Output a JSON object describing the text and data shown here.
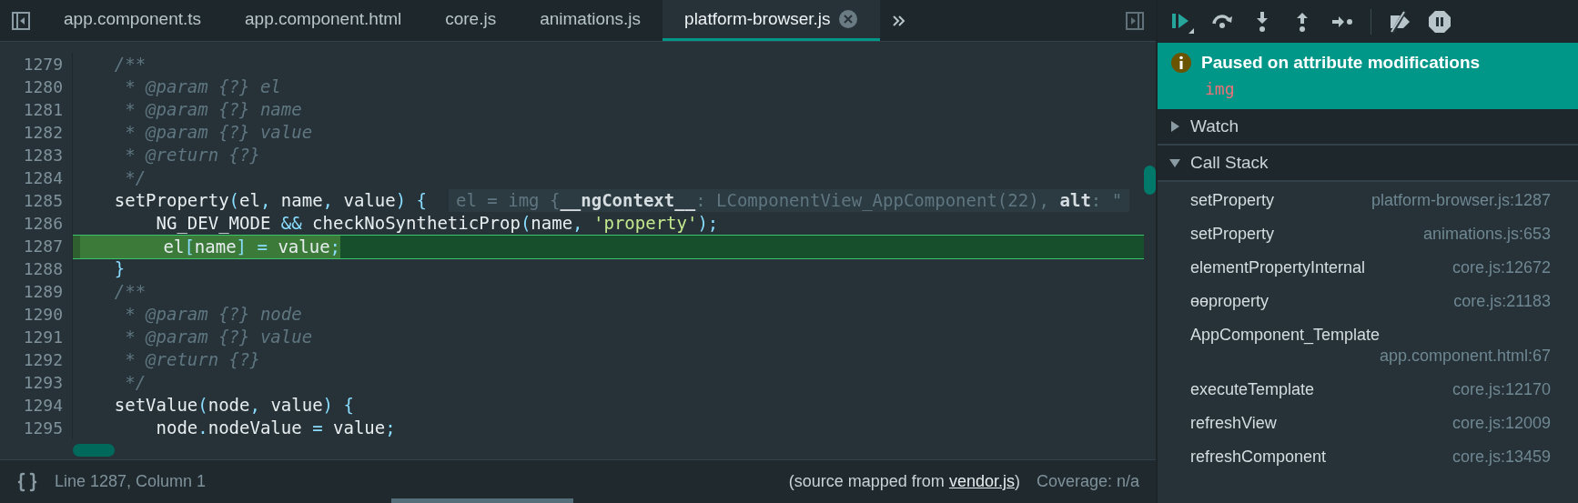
{
  "tabs": [
    {
      "label": "app.component.ts",
      "selected": false
    },
    {
      "label": "app.component.html",
      "selected": false
    },
    {
      "label": "core.js",
      "selected": false
    },
    {
      "label": "animations.js",
      "selected": false
    },
    {
      "label": "platform-browser.js",
      "selected": true
    }
  ],
  "code_lines": [
    {
      "number": "1279",
      "paused": false,
      "tokens": [
        {
          "text": "    /**",
          "kind": "comment"
        }
      ]
    },
    {
      "number": "1280",
      "paused": false,
      "tokens": [
        {
          "text": "     * @param {?} el",
          "kind": "comment"
        }
      ]
    },
    {
      "number": "1281",
      "paused": false,
      "tokens": [
        {
          "text": "     * @param {?} name",
          "kind": "comment"
        }
      ]
    },
    {
      "number": "1282",
      "paused": false,
      "tokens": [
        {
          "text": "     * @param {?} value",
          "kind": "comment"
        }
      ]
    },
    {
      "number": "1283",
      "paused": false,
      "tokens": [
        {
          "text": "     * @return {?}",
          "kind": "comment"
        }
      ]
    },
    {
      "number": "1284",
      "paused": false,
      "tokens": [
        {
          "text": "     */",
          "kind": "comment"
        }
      ]
    },
    {
      "number": "1285",
      "paused": false,
      "tokens": [
        {
          "text": "    setProperty",
          "kind": "plain"
        },
        {
          "text": "(",
          "kind": "punct"
        },
        {
          "text": "el",
          "kind": "plain"
        },
        {
          "text": ", ",
          "kind": "punct"
        },
        {
          "text": "name",
          "kind": "plain"
        },
        {
          "text": ", ",
          "kind": "punct"
        },
        {
          "text": "value",
          "kind": "plain"
        },
        {
          "text": ") {",
          "kind": "punct"
        }
      ],
      "hint": [
        {
          "text": "el = img {",
          "kind": "hint"
        },
        {
          "text": "__ngContext__",
          "kind": "hint-key"
        },
        {
          "text": ": LComponentView_AppComponent(22), ",
          "kind": "hint"
        },
        {
          "text": "alt",
          "kind": "hint-key"
        },
        {
          "text": ": \"",
          "kind": "hint"
        }
      ]
    },
    {
      "number": "1286",
      "paused": false,
      "tokens": [
        {
          "text": "        NG_DEV_MODE ",
          "kind": "plain"
        },
        {
          "text": "&&",
          "kind": "punct"
        },
        {
          "text": " checkNoSyntheticProp",
          "kind": "plain"
        },
        {
          "text": "(",
          "kind": "punct"
        },
        {
          "text": "name",
          "kind": "plain"
        },
        {
          "text": ", ",
          "kind": "punct"
        },
        {
          "text": "'property'",
          "kind": "string"
        },
        {
          "text": ");",
          "kind": "punct"
        }
      ]
    },
    {
      "number": "1287",
      "paused": true,
      "tokens": [
        {
          "text": "        el",
          "kind": "plain"
        },
        {
          "text": "[",
          "kind": "punct"
        },
        {
          "text": "name",
          "kind": "plain"
        },
        {
          "text": "]",
          "kind": "punct"
        },
        {
          "text": " = ",
          "kind": "punct"
        },
        {
          "text": "value",
          "kind": "plain"
        },
        {
          "text": ";",
          "kind": "punct"
        }
      ]
    },
    {
      "number": "1288",
      "paused": false,
      "tokens": [
        {
          "text": "    }",
          "kind": "punct"
        }
      ]
    },
    {
      "number": "1289",
      "paused": false,
      "tokens": [
        {
          "text": "    /**",
          "kind": "comment"
        }
      ]
    },
    {
      "number": "1290",
      "paused": false,
      "tokens": [
        {
          "text": "     * @param {?} node",
          "kind": "comment"
        }
      ]
    },
    {
      "number": "1291",
      "paused": false,
      "tokens": [
        {
          "text": "     * @param {?} value",
          "kind": "comment"
        }
      ]
    },
    {
      "number": "1292",
      "paused": false,
      "tokens": [
        {
          "text": "     * @return {?}",
          "kind": "comment"
        }
      ]
    },
    {
      "number": "1293",
      "paused": false,
      "tokens": [
        {
          "text": "     */",
          "kind": "comment"
        }
      ]
    },
    {
      "number": "1294",
      "paused": false,
      "tokens": [
        {
          "text": "    setValue",
          "kind": "plain"
        },
        {
          "text": "(",
          "kind": "punct"
        },
        {
          "text": "node",
          "kind": "plain"
        },
        {
          "text": ", ",
          "kind": "punct"
        },
        {
          "text": "value",
          "kind": "plain"
        },
        {
          "text": ") {",
          "kind": "punct"
        }
      ]
    },
    {
      "number": "1295",
      "paused": false,
      "tokens": [
        {
          "text": "        node",
          "kind": "plain"
        },
        {
          "text": ".",
          "kind": "punct"
        },
        {
          "text": "nodeValue ",
          "kind": "plain"
        },
        {
          "text": "=",
          "kind": "punct"
        },
        {
          "text": " value",
          "kind": "plain"
        },
        {
          "text": ";",
          "kind": "punct"
        }
      ]
    }
  ],
  "status_bar": {
    "position": "Line 1287, Column 1",
    "source_prefix": "(source mapped from ",
    "source_link": "vendor.js",
    "source_suffix": ")",
    "coverage": "Coverage: n/a"
  },
  "paused_banner": {
    "title": "Paused on attribute modifications",
    "target": "img"
  },
  "sections": [
    {
      "title": "Watch",
      "expanded": false
    },
    {
      "title": "Call Stack",
      "expanded": true
    }
  ],
  "call_stack": [
    {
      "function": "setProperty",
      "location": "platform-browser.js:1287"
    },
    {
      "function": "setProperty",
      "location": "animations.js:653"
    },
    {
      "function": "elementPropertyInternal",
      "location": "core.js:12672"
    },
    {
      "function": "ɵɵproperty",
      "location": "core.js:21183"
    },
    {
      "function": "AppComponent_Template",
      "location": "app.component.html:67"
    },
    {
      "function": "executeTemplate",
      "location": "core.js:12170"
    },
    {
      "function": "refreshView",
      "location": "core.js:12009"
    },
    {
      "function": "refreshComponent",
      "location": "core.js:13459"
    }
  ]
}
